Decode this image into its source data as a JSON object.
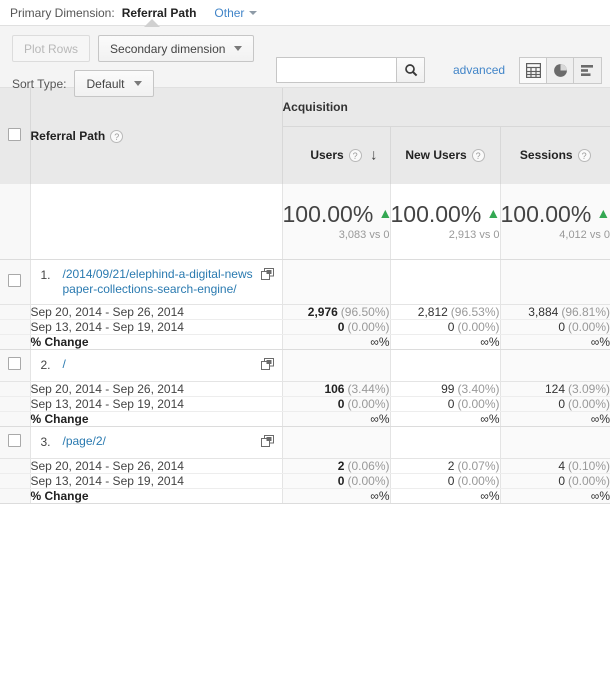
{
  "primary_dimension": {
    "label": "Primary Dimension:",
    "value": "Referral Path",
    "other": "Other"
  },
  "toolbar": {
    "plot_rows": "Plot Rows",
    "secondary_dimension": "Secondary dimension",
    "sort_type_label": "Sort Type:",
    "sort_type_value": "Default",
    "search_value": "",
    "search_placeholder": "",
    "advanced": "advanced",
    "views": [
      {
        "name": "table-view",
        "icon": "grid-icon",
        "active": true
      },
      {
        "name": "pie-view",
        "icon": "pie-chart-icon",
        "active": false
      },
      {
        "name": "bar-view",
        "icon": "bar-chart-icon",
        "active": false
      }
    ]
  },
  "table": {
    "group_header": "Acquisition",
    "dimension_header": "Referral Path",
    "metrics": [
      {
        "label": "Users",
        "sorted": true
      },
      {
        "label": "New Users",
        "sorted": false
      },
      {
        "label": "Sessions",
        "sorted": false
      }
    ],
    "summary": [
      {
        "pct": "100.00%",
        "trend": "up",
        "sub": "3,083 vs 0"
      },
      {
        "pct": "100.00%",
        "trend": "up",
        "sub": "2,913 vs 0"
      },
      {
        "pct": "100.00%",
        "trend": "up",
        "sub": "4,012 vs 0"
      }
    ],
    "period_current": "Sep 20, 2014 - Sep 26, 2014",
    "period_previous": "Sep 13, 2014 - Sep 19, 2014",
    "change_label": "% Change",
    "infinity": "∞%",
    "rows": [
      {
        "index": "1.",
        "path": "/2014/09/21/elephind-a-digital-newspaper-collections-search-engine/",
        "current": [
          {
            "value": "2,976",
            "pct": "(96.50%)"
          },
          {
            "value": "2,812",
            "pct": "(96.53%)"
          },
          {
            "value": "3,884",
            "pct": "(96.81%)"
          }
        ],
        "previous": [
          {
            "value": "0",
            "pct": "(0.00%)"
          },
          {
            "value": "0",
            "pct": "(0.00%)"
          },
          {
            "value": "0",
            "pct": "(0.00%)"
          }
        ],
        "change": [
          "∞%",
          "∞%",
          "∞%"
        ]
      },
      {
        "index": "2.",
        "path": "/",
        "current": [
          {
            "value": "106",
            "pct": "(3.44%)"
          },
          {
            "value": "99",
            "pct": "(3.40%)"
          },
          {
            "value": "124",
            "pct": "(3.09%)"
          }
        ],
        "previous": [
          {
            "value": "0",
            "pct": "(0.00%)"
          },
          {
            "value": "0",
            "pct": "(0.00%)"
          },
          {
            "value": "0",
            "pct": "(0.00%)"
          }
        ],
        "change": [
          "∞%",
          "∞%",
          "∞%"
        ]
      },
      {
        "index": "3.",
        "path": "/page/2/",
        "current": [
          {
            "value": "2",
            "pct": "(0.06%)"
          },
          {
            "value": "2",
            "pct": "(0.07%)"
          },
          {
            "value": "4",
            "pct": "(0.10%)"
          }
        ],
        "previous": [
          {
            "value": "0",
            "pct": "(0.00%)"
          },
          {
            "value": "0",
            "pct": "(0.00%)"
          },
          {
            "value": "0",
            "pct": "(0.00%)"
          }
        ],
        "change": [
          "∞%",
          "∞%",
          "∞%"
        ]
      }
    ]
  },
  "colors": {
    "link": "#2a7ab0",
    "accent": "#4285c8",
    "positive": "#34a853",
    "header_bg": "#e9e9e9"
  }
}
